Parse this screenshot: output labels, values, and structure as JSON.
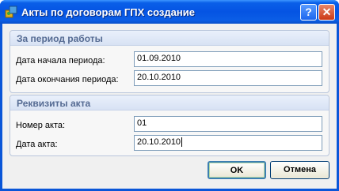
{
  "window": {
    "title": "Акты по договорам ГПХ создание",
    "help_label": "?",
    "close_label": "✕"
  },
  "period_group": {
    "title": "За период работы",
    "start_label": "Дата начала периода:",
    "start_value": "01.09.2010",
    "end_label": "Дата окончания периода:",
    "end_value": "20.10.2010"
  },
  "act_group": {
    "title": "Реквизиты акта",
    "number_label": "Номер акта:",
    "number_value": "01",
    "date_label": "Дата акта:",
    "date_value": "20.10.2010"
  },
  "buttons": {
    "ok": "OK",
    "cancel": "Отмена"
  },
  "colors": {
    "titlebar": "#0554e3",
    "group_title": "#556b93"
  }
}
